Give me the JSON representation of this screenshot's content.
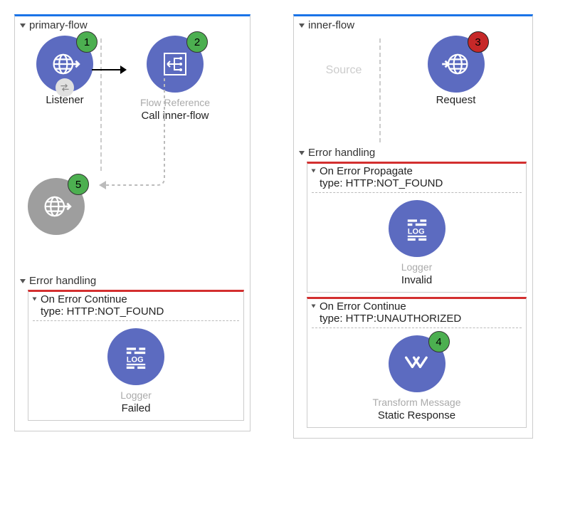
{
  "primary": {
    "title": "primary-flow",
    "listener_label": "Listener",
    "flowref_caption": "Flow Reference",
    "flowref_label": "Call inner-flow",
    "error_title": "Error handling",
    "on_error_continue": "On Error Continue",
    "on_error_type": "type: HTTP:NOT_FOUND",
    "logger_caption": "Logger",
    "logger_label": "Failed",
    "badge1": "1",
    "badge2": "2",
    "badge5": "5"
  },
  "inner": {
    "title": "inner-flow",
    "source_placeholder": "Source",
    "request_label": "Request",
    "error_title": "Error handling",
    "propagate_title": "On Error Propagate",
    "propagate_type": "type: HTTP:NOT_FOUND",
    "propagate_logger_caption": "Logger",
    "propagate_logger_label": "Invalid",
    "continue_title": "On Error Continue",
    "continue_type": "type: HTTP:UNAUTHORIZED",
    "transform_caption": "Transform Message",
    "transform_label": "Static Response",
    "badge3": "3",
    "badge4": "4"
  }
}
